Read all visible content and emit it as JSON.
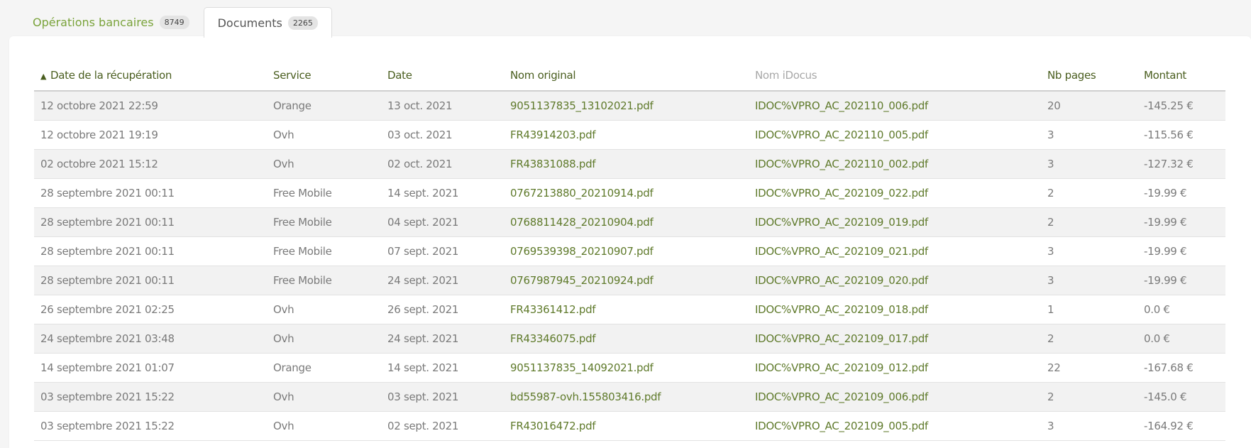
{
  "tabs": [
    {
      "label": "Opérations bancaires",
      "count": "8749"
    },
    {
      "label": "Documents",
      "count": "2265"
    }
  ],
  "table": {
    "columns": {
      "retrieval_date": "Date de la récupération",
      "service": "Service",
      "date": "Date",
      "original_name": "Nom original",
      "idocus_name": "Nom iDocus",
      "pages": "Nb pages",
      "amount": "Montant"
    },
    "rows": [
      [
        "12 octobre 2021 22:59",
        "Orange",
        "13 oct. 2021",
        "9051137835_13102021.pdf",
        "IDOC%VPRO_AC_202110_006.pdf",
        "20",
        "-145.25 €"
      ],
      [
        "12 octobre 2021 19:19",
        "Ovh",
        "03 oct. 2021",
        "FR43914203.pdf",
        "IDOC%VPRO_AC_202110_005.pdf",
        "3",
        "-115.56 €"
      ],
      [
        "02 octobre 2021 15:12",
        "Ovh",
        "02 oct. 2021",
        "FR43831088.pdf",
        "IDOC%VPRO_AC_202110_002.pdf",
        "3",
        "-127.32 €"
      ],
      [
        "28 septembre 2021 00:11",
        "Free Mobile",
        "14 sept. 2021",
        "0767213880_20210914.pdf",
        "IDOC%VPRO_AC_202109_022.pdf",
        "2",
        "-19.99 €"
      ],
      [
        "28 septembre 2021 00:11",
        "Free Mobile",
        "04 sept. 2021",
        "0768811428_20210904.pdf",
        "IDOC%VPRO_AC_202109_019.pdf",
        "2",
        "-19.99 €"
      ],
      [
        "28 septembre 2021 00:11",
        "Free Mobile",
        "07 sept. 2021",
        "0769539398_20210907.pdf",
        "IDOC%VPRO_AC_202109_021.pdf",
        "3",
        "-19.99 €"
      ],
      [
        "28 septembre 2021 00:11",
        "Free Mobile",
        "24 sept. 2021",
        "0767987945_20210924.pdf",
        "IDOC%VPRO_AC_202109_020.pdf",
        "3",
        "-19.99 €"
      ],
      [
        "26 septembre 2021 02:25",
        "Ovh",
        "26 sept. 2021",
        "FR43361412.pdf",
        "IDOC%VPRO_AC_202109_018.pdf",
        "1",
        "0.0 €"
      ],
      [
        "24 septembre 2021 03:48",
        "Ovh",
        "24 sept. 2021",
        "FR43346075.pdf",
        "IDOC%VPRO_AC_202109_017.pdf",
        "2",
        "0.0 €"
      ],
      [
        "14 septembre 2021 01:07",
        "Orange",
        "14 sept. 2021",
        "9051137835_14092021.pdf",
        "IDOC%VPRO_AC_202109_012.pdf",
        "22",
        "-167.68 €"
      ],
      [
        "03 septembre 2021 15:22",
        "Ovh",
        "03 sept. 2021",
        "bd55987-ovh.155803416.pdf",
        "IDOC%VPRO_AC_202109_006.pdf",
        "2",
        "-145.0 €"
      ],
      [
        "03 septembre 2021 15:22",
        "Ovh",
        "02 sept. 2021",
        "FR43016472.pdf",
        "IDOC%VPRO_AC_202109_005.pdf",
        "3",
        "-164.92 €"
      ]
    ]
  }
}
